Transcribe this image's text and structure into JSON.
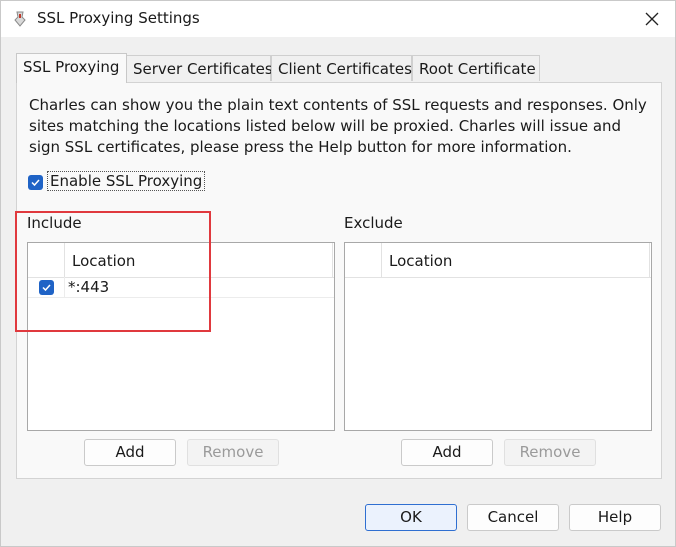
{
  "window": {
    "title": "SSL Proxying Settings"
  },
  "tabs": [
    {
      "label": "SSL Proxying",
      "active": true
    },
    {
      "label": "Server Certificates",
      "active": false
    },
    {
      "label": "Client Certificates",
      "active": false
    },
    {
      "label": "Root Certificate",
      "active": false
    }
  ],
  "panel": {
    "description": "Charles can show you the plain text contents of SSL requests and responses. Only sites matching the locations listed below will be proxied. Charles will issue and sign SSL certificates, please press the Help button for more information.",
    "enable_label": "Enable SSL Proxying",
    "enable_checked": true
  },
  "include": {
    "label": "Include",
    "column": "Location",
    "rows": [
      {
        "checked": true,
        "location": "*:443"
      }
    ],
    "add_label": "Add",
    "remove_label": "Remove"
  },
  "exclude": {
    "label": "Exclude",
    "column": "Location",
    "rows": [],
    "add_label": "Add",
    "remove_label": "Remove"
  },
  "footer": {
    "ok_label": "OK",
    "cancel_label": "Cancel",
    "help_label": "Help"
  },
  "colors": {
    "accent": "#1f63c6",
    "highlight": "#e0393e"
  },
  "icons": {
    "app": "charles-app-icon",
    "close": "close-icon",
    "check": "checkmark-icon"
  }
}
